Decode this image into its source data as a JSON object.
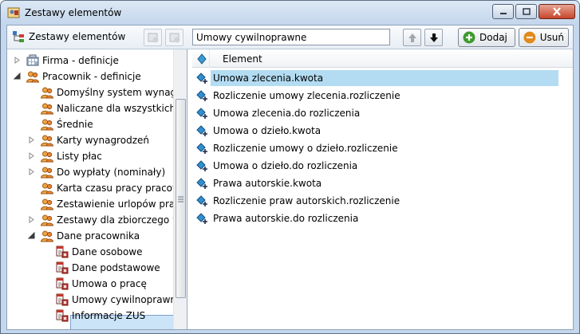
{
  "window": {
    "title": "Zestawy elementów"
  },
  "toolbar": {
    "label": "Zestawy elementów",
    "name_value": "Umowy cywilnoprawne",
    "add_label": "Dodaj",
    "remove_label": "Usuń"
  },
  "tree": {
    "items": [
      {
        "label": "Firma - definicje",
        "icon": "company-icon",
        "expander": "collapsed"
      },
      {
        "label": "Pracownik - definicje",
        "icon": "people-icon",
        "expander": "expanded"
      },
      {
        "label": "Domyślny system wynagrod",
        "icon": "people-icon",
        "expander": "none"
      },
      {
        "label": "Naliczane dla wszystkich pra",
        "icon": "people-icon",
        "expander": "none"
      },
      {
        "label": "Średnie",
        "icon": "people-icon",
        "expander": "none"
      },
      {
        "label": "Karty wynagrodzeń",
        "icon": "people-icon",
        "expander": "collapsed"
      },
      {
        "label": "Listy płac",
        "icon": "people-icon",
        "expander": "collapsed"
      },
      {
        "label": "Do wypłaty (nominały)",
        "icon": "people-icon",
        "expander": "collapsed"
      },
      {
        "label": "Karta czasu pracy pracownik",
        "icon": "people-icon",
        "expander": "none"
      },
      {
        "label": "Zestawienie urlopów pracov",
        "icon": "people-icon",
        "expander": "none"
      },
      {
        "label": "Zestawy dla zbiorczego wpro",
        "icon": "people-icon",
        "expander": "collapsed"
      },
      {
        "label": "Dane pracownika",
        "icon": "people-icon",
        "expander": "expanded"
      },
      {
        "label": "Dane osobowe",
        "icon": "element-set-icon",
        "expander": "none"
      },
      {
        "label": "Dane podstawowe",
        "icon": "element-set-icon",
        "expander": "none"
      },
      {
        "label": "Umowa o pracę",
        "icon": "element-set-icon",
        "expander": "none"
      },
      {
        "label": "Umowy cywilnoprawne",
        "icon": "element-set-icon",
        "expander": "none"
      },
      {
        "label": "Informacje ZUS",
        "icon": "element-set-icon",
        "expander": "none"
      }
    ]
  },
  "list": {
    "header": "Element",
    "rows": [
      "Umowa zlecenia.kwota",
      "Rozliczenie umowy zlecenia.rozliczenie",
      "Umowa zlecenia.do rozliczenia",
      "Umowa o dzieło.kwota",
      "Rozliczenie umowy o dzieło.rozliczenie",
      "Umowa o dzieło.do rozliczenia",
      "Prawa autorskie.kwota",
      "Rozliczenie praw autorskich.rozliczenie",
      "Prawa autorskie.do rozliczenia"
    ]
  },
  "colors": {
    "accent": "#b3dcf2",
    "add_icon": "#3f9a2f",
    "remove_icon": "#e28a1c"
  }
}
